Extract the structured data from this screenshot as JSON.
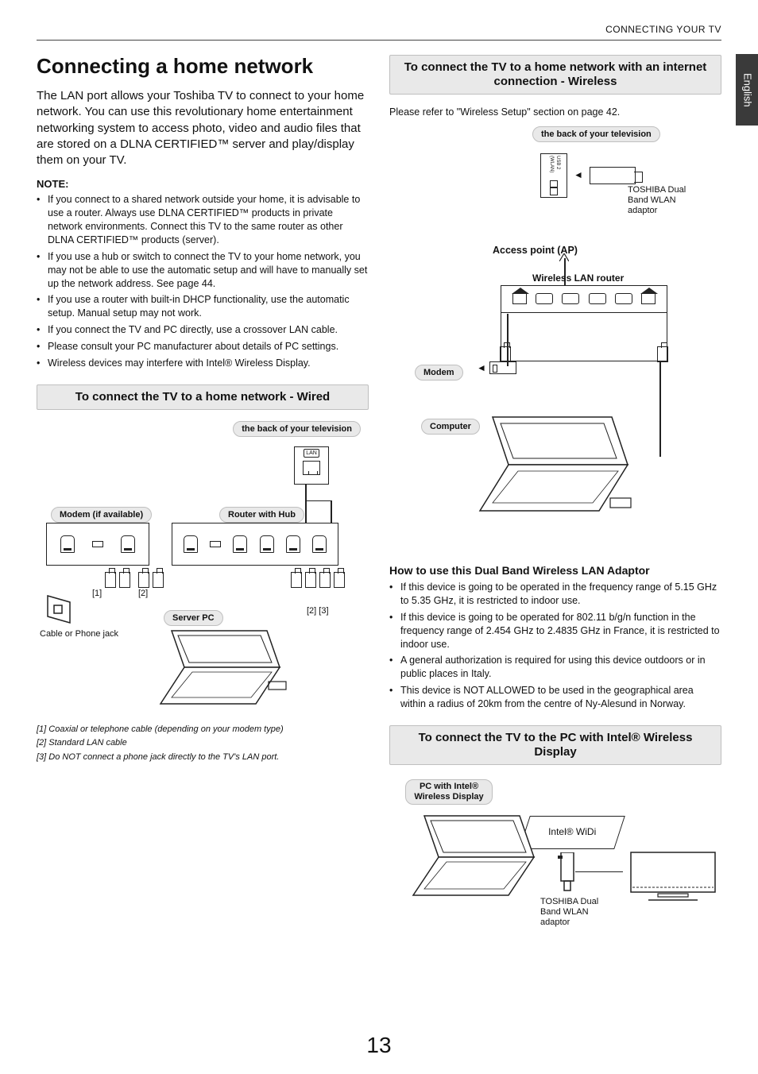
{
  "header": {
    "breadcrumb": "CONNECTING YOUR TV"
  },
  "side_tab": "English",
  "page_number": "13",
  "left": {
    "title": "Connecting a home network",
    "intro": "The LAN port allows your Toshiba TV to connect to your home network. You can use this revolutionary home entertainment networking system to access photo, video and audio files that are stored on a DLNA CERTIFIED™ server and play/display them on your TV.",
    "note_head": "NOTE:",
    "notes": [
      "If you connect to a shared network outside your home, it is advisable to use a router. Always use DLNA CERTIFIED™ products in private network environments. Connect this TV to the same router as other DLNA CERTIFIED™ products (server).",
      "If you use a hub or switch to connect the TV to your home network, you may not be able to use the automatic setup and will have to manually set up the network address. See page 44.",
      "If you use a router with built-in DHCP functionality, use the automatic setup. Manual setup may not work.",
      "If you connect the TV and PC directly, use a crossover LAN cable.",
      "Please consult your PC manufacturer about details of PC settings.",
      "Wireless devices may interfere with Intel® Wireless Display."
    ],
    "wired_heading": "To connect the TV to a home network - Wired",
    "tv_back_label": "the back of your television",
    "modem_label": "Modem (if available)",
    "router_label": "Router with Hub",
    "server_label": "Server PC",
    "cable_jack": "Cable or Phone jack",
    "num1": "[1]",
    "num2": "[2]",
    "num23": "[2] [3]",
    "footnotes": [
      "[1] Coaxial or telephone cable (depending on your modem type)",
      "[2] Standard LAN cable",
      "[3] Do NOT connect a phone jack directly to the TV's LAN port."
    ]
  },
  "right": {
    "wireless_heading": "To connect the TV to a home network with an internet connection - Wireless",
    "wireless_intro": "Please refer to \"Wireless Setup\" section on page 42.",
    "tv_back_label": "the back of your television",
    "adaptor_label": "TOSHIBA Dual Band WLAN adaptor",
    "ap_label": "Access point (AP)",
    "wlan_router_label": "Wireless LAN router",
    "modem_label": "Modem",
    "computer_label": "Computer",
    "dual_band_head": "How to use this Dual Band Wireless LAN Adaptor",
    "dual_band_notes": [
      "If this device is going to be operated in the frequency range of 5.15 GHz to 5.35 GHz, it is restricted to indoor use.",
      "If this device is going to be operated for 802.11 b/g/n function in the frequency range of 2.454 GHz to 2.4835 GHz in France, it is restricted to indoor use.",
      "A general authorization is required for using this device outdoors or in public places in Italy.",
      "This device is NOT ALLOWED to be used in the geographical area within a radius of 20km from the centre of Ny-Alesund in Norway."
    ],
    "widi_heading": "To connect the TV to the PC with Intel® Wireless Display",
    "pc_widi_label": "PC with Intel® Wireless Display",
    "widi_bubble": "Intel® WiDi",
    "adaptor_label2": "TOSHIBA Dual Band WLAN adaptor"
  }
}
